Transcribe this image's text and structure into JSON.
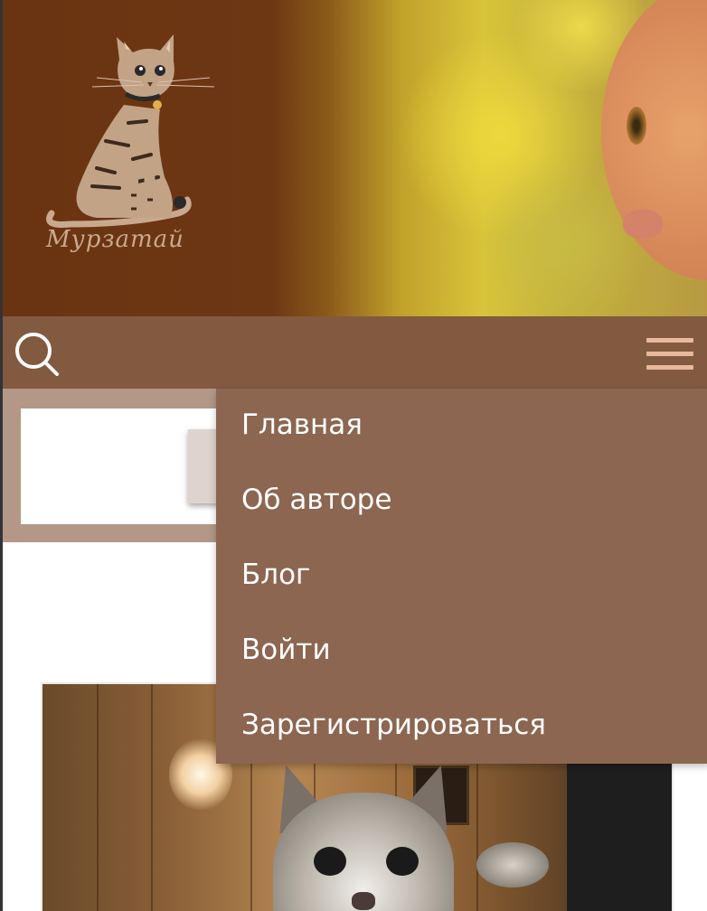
{
  "site": {
    "logo_text": "Мурзатай"
  },
  "navbar": {
    "search_icon": "search-icon",
    "menu_icon": "hamburger-menu-icon"
  },
  "dropdown": {
    "items": [
      {
        "label": "Главная"
      },
      {
        "label": "Об авторе"
      },
      {
        "label": "Блог"
      },
      {
        "label": "Войти"
      },
      {
        "label": "Зарегистрироваться"
      }
    ]
  },
  "colors": {
    "header_brown": "#6a3412",
    "navbar": "#825a40",
    "dropdown": "#8c6650",
    "search_panel": "#b39887",
    "menu_icon": "#e9b99b"
  }
}
